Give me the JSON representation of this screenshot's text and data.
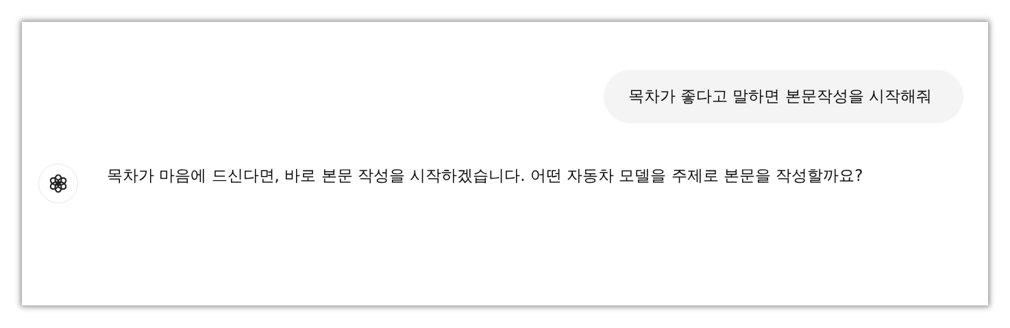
{
  "messages": [
    {
      "kind": "user",
      "text": "목차가 좋다고 말하면 본문작성을 시작해줘"
    },
    {
      "kind": "assistant",
      "text": "목차가 마음에 드신다면, 바로 본문 작성을 시작하겠습니다. 어떤 자동차 모델을 주제로 본문을 작성할까요?"
    }
  ]
}
